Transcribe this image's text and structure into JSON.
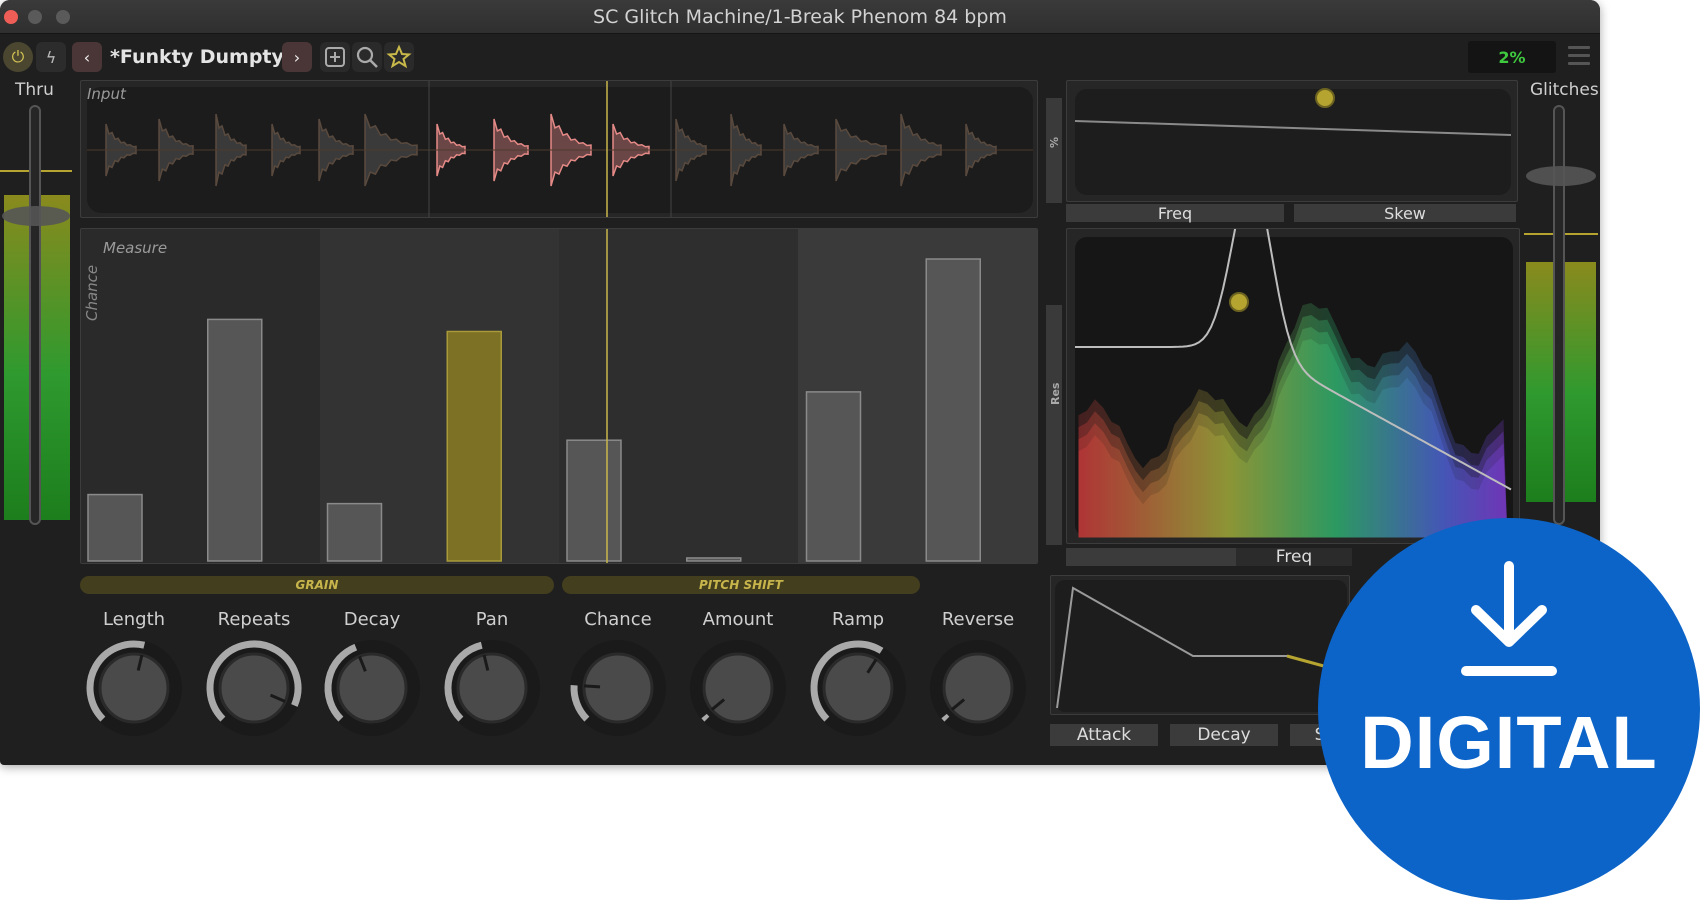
{
  "window": {
    "title": "SC Glitch Machine/1-Break Phenom 84 bpm"
  },
  "toolbar": {
    "power_icon": "power-icon",
    "bolt_icon": "lightning-icon",
    "prev_label": "‹",
    "next_label": "›",
    "preset_name": "*Funkty Dumpty",
    "preset_arrows": "⬍",
    "add_icon": "add-preset-icon",
    "search_icon": "search-icon",
    "favorite_icon": "star-icon",
    "cpu": "2%"
  },
  "left": {
    "label": "Thru"
  },
  "right": {
    "label": "Glitches"
  },
  "input_panel": {
    "label": "Input"
  },
  "measure_panel": {
    "label": "Measure",
    "axis_label": "Chance",
    "steps": [
      0.22,
      0.8,
      0.19,
      0.76,
      0.4,
      0.01,
      0.56,
      1.0
    ],
    "active_step": 4
  },
  "filter_top": {
    "y_label": "%",
    "freq_label": "Freq",
    "skew_label": "Skew"
  },
  "filter_main": {
    "y_label": "Res",
    "freq_label": "Freq"
  },
  "sections": {
    "grain": "GRAIN",
    "pitch": "PITCH SHIFT"
  },
  "knobs": [
    {
      "label": "Length"
    },
    {
      "label": "Repeats"
    },
    {
      "label": "Decay"
    },
    {
      "label": "Pan"
    },
    {
      "label": "Chance"
    },
    {
      "label": "Amount"
    },
    {
      "label": "Ramp"
    },
    {
      "label": "Reverse"
    }
  ],
  "envelope": {
    "attack_label": "Attack",
    "decay_label": "Decay",
    "sustain_label": "S"
  },
  "badge": {
    "text": "DIGITAL",
    "icon": "download-icon"
  },
  "colors": {
    "accent": "#c7b54c",
    "cpu_green": "#3fc93f",
    "badge_blue": "#0c64c8"
  }
}
